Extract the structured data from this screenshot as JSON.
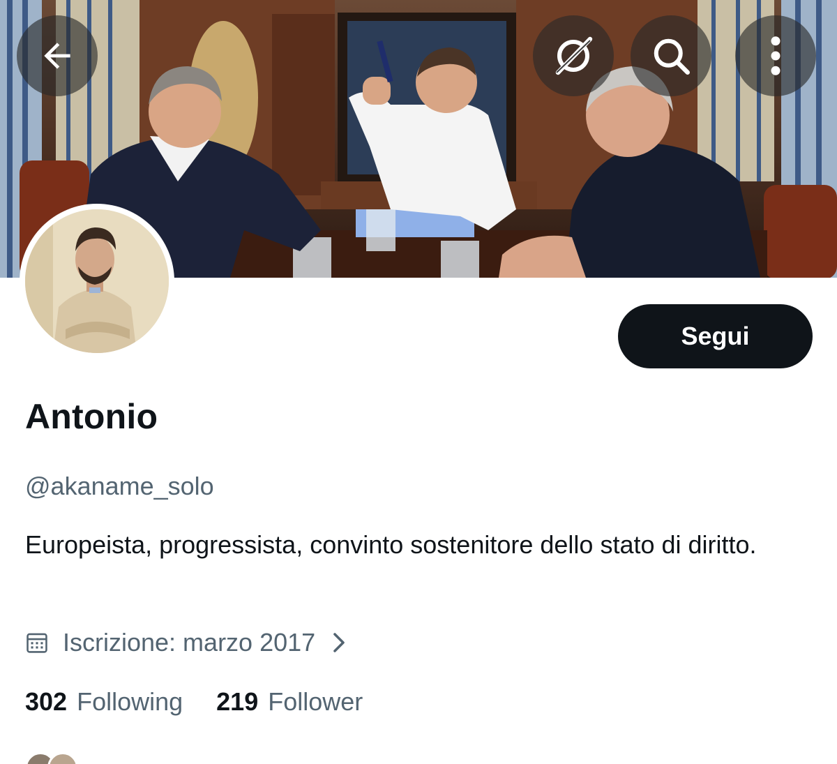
{
  "profile": {
    "display_name": "Antonio",
    "handle": "@akaname_solo",
    "bio": "Europeista, progressista, convinto sostenitore dello stato di diritto.",
    "joined": "Iscrizione: marzo 2017",
    "following_count": "302",
    "following_label": "Following",
    "followers_count": "219",
    "followers_label": "Follower"
  },
  "actions": {
    "follow_label": "Segui"
  },
  "header": {
    "icons": [
      "back-arrow-icon",
      "grok-icon",
      "search-icon",
      "more-vertical-icon"
    ]
  },
  "colors": {
    "primary_text": "#0f1419",
    "secondary_text": "#536471",
    "button_bg": "#0f1419",
    "button_text": "#ffffff",
    "nav_button_bg": "rgba(40,40,40,0.62)"
  }
}
